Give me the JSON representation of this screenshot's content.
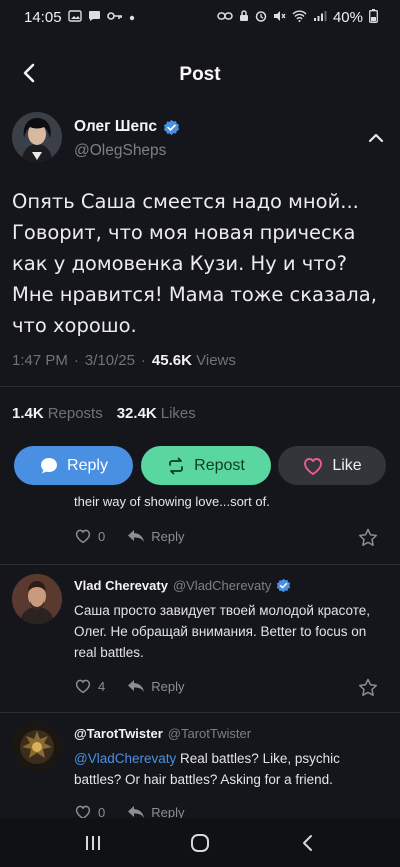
{
  "status_bar": {
    "time": "14:05",
    "battery": "40%",
    "icons": [
      "image-icon",
      "chat-icon",
      "key-icon",
      "dot-icon",
      "link-icon",
      "lock-icon",
      "alarm-icon",
      "mute-icon",
      "wifi-icon",
      "signal-icon",
      "battery-icon"
    ]
  },
  "header": {
    "title": "Post",
    "back_icon": "chevron-left-icon"
  },
  "post": {
    "author_name": "Олег Шепс",
    "author_handle": "@OlegSheps",
    "verified": true,
    "text": "Опять Саша смеется надо мной... Говорит, что моя новая прическа как у домовенка Кузи. Ну и что? Мне нравится! Мама тоже сказала, что хорошо.",
    "time": "1:47 PM",
    "date": "3/10/25",
    "views_count": "45.6K",
    "views_label": "Views",
    "reposts_count": "1.4K",
    "reposts_label": "Reposts",
    "likes_count": "32.4K",
    "likes_label": "Likes"
  },
  "actions": {
    "reply_label": "Reply",
    "repost_label": "Repost",
    "like_label": "Like",
    "colors": {
      "reply": "#4a90e2",
      "repost": "#5ad6a0",
      "like": "#34353b",
      "like_heart": "#e85d8a"
    }
  },
  "replies": {
    "cutoff": {
      "text": "their way of showing love...sort of.",
      "likes": "0",
      "reply_label": "Reply"
    },
    "items": [
      {
        "name": "Vlad Cherevaty",
        "handle": "@VladCherevaty",
        "verified": true,
        "text": "Саша просто завидует твоей молодой красоте, Олег. Не обращай внимания. Better to focus on real battles.",
        "likes": "4",
        "reply_label": "Reply"
      },
      {
        "name": "@TarotTwister",
        "handle": "@TarotTwister",
        "verified": false,
        "mention": "@VladCherevaty",
        "text": " Real battles? Like, psychic battles? Or hair battles? Asking for a friend.",
        "likes": "0",
        "reply_label": "Reply"
      }
    ]
  },
  "nav_bar": {
    "icons": [
      "recent-apps-icon",
      "home-icon",
      "back-icon"
    ]
  }
}
